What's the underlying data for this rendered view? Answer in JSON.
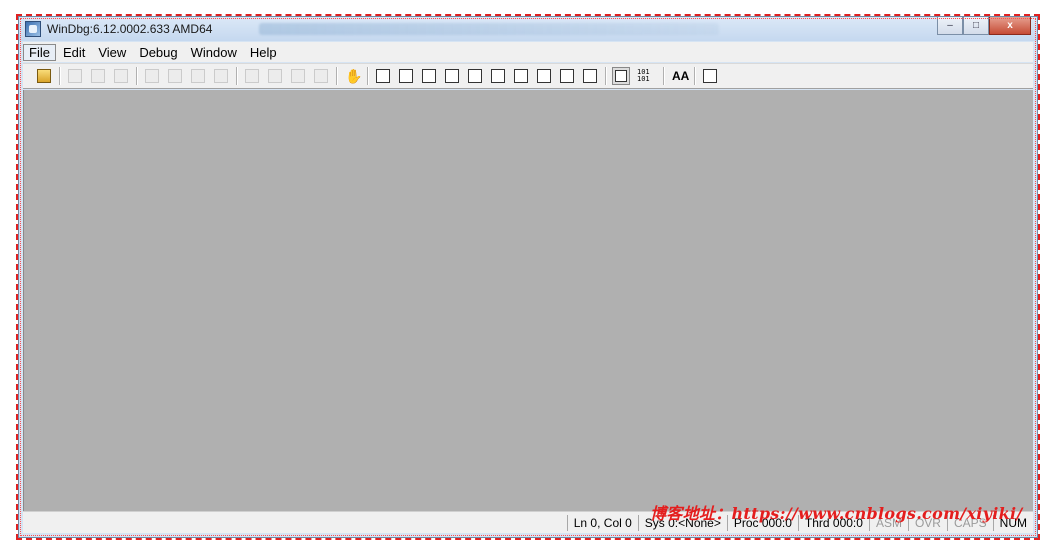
{
  "window": {
    "title": "WinDbg:6.12.0002.633 AMD64",
    "caption_minimize": "–",
    "caption_maximize": "□",
    "caption_close": "x"
  },
  "menubar": {
    "items": [
      {
        "label": "File"
      },
      {
        "label": "Edit"
      },
      {
        "label": "View"
      },
      {
        "label": "Debug"
      },
      {
        "label": "Window"
      },
      {
        "label": "Help"
      }
    ]
  },
  "toolbar": {
    "font_label": "AA",
    "binary_label": "101 101"
  },
  "statusbar": {
    "position": "Ln 0, Col 0",
    "sys": "Sys 0:<None>",
    "proc": "Proc 000:0",
    "thread": "Thrd 000:0",
    "asm": "ASM",
    "ovr": "OVR",
    "caps": "CAPS",
    "num": "NUM"
  },
  "watermark": "博客地址：https://www.cnblogs.com/xiyiki/"
}
